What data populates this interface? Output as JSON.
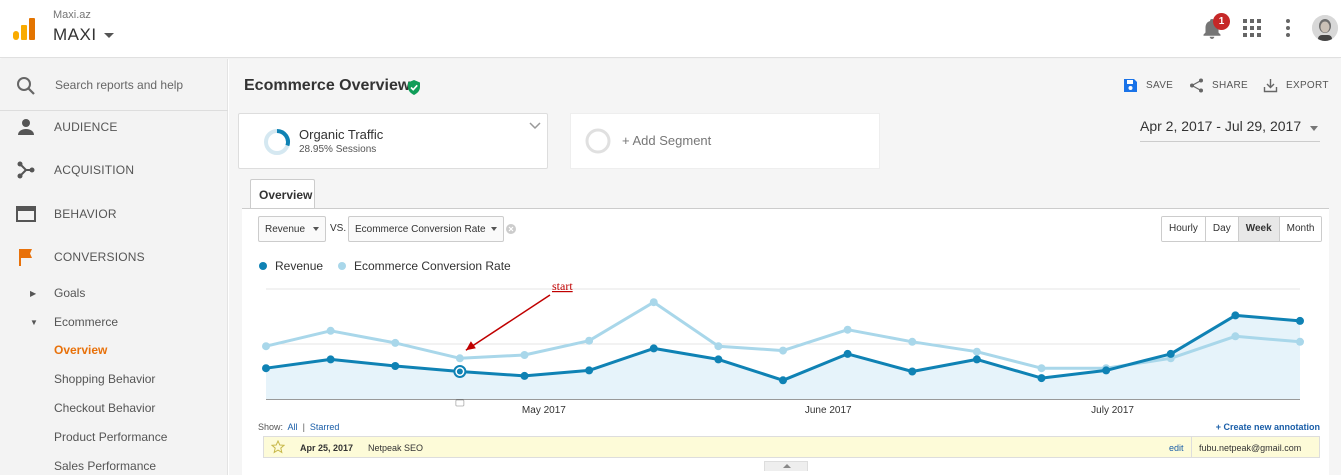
{
  "header": {
    "account_sub": "Maxi.az",
    "account_name": "MAXI",
    "notification_count": "1"
  },
  "sidebar": {
    "search_placeholder": "Search reports and help",
    "sections": [
      {
        "label": "AUDIENCE",
        "icon": "person-icon"
      },
      {
        "label": "ACQUISITION",
        "icon": "acquisition-icon"
      },
      {
        "label": "BEHAVIOR",
        "icon": "behavior-icon"
      },
      {
        "label": "CONVERSIONS",
        "icon": "flag-icon"
      }
    ],
    "sub_items": [
      {
        "label": "Goals",
        "arrow": "▶"
      },
      {
        "label": "Ecommerce",
        "arrow": "▼"
      },
      {
        "label": "Overview"
      },
      {
        "label": "Shopping Behavior"
      },
      {
        "label": "Checkout Behavior"
      },
      {
        "label": "Product Performance"
      },
      {
        "label": "Sales Performance"
      }
    ]
  },
  "main": {
    "title": "Ecommerce Overview",
    "actions": {
      "save": "SAVE",
      "share": "SHARE",
      "export": "EXPORT"
    },
    "segment": {
      "name": "Organic Traffic",
      "sub": "28.95% Sessions"
    },
    "add_segment": "+ Add Segment",
    "date_range": "Apr 2, 2017 - Jul 29, 2017",
    "tab": "Overview",
    "metric1": "Revenue",
    "vs": "VS.",
    "metric2": "Ecommerce Conversion Rate",
    "granularity": [
      "Hourly",
      "Day",
      "Week",
      "Month"
    ],
    "granularity_selected": "Week",
    "annotation_callout": "start",
    "annotations": {
      "show": "Show:",
      "all": "All",
      "divider": "|",
      "starred": "Starred",
      "create": "+ Create new annotation",
      "date": "Apr 25, 2017",
      "text": "Netpeak SEO",
      "edit": "edit",
      "email": "fubu.netpeak@gmail.com"
    }
  },
  "colors": {
    "revenue": "#0f82b4",
    "conversion": "#a9d7ea",
    "active": "#e8710a",
    "flag": "#e8710a"
  },
  "chart_data": {
    "type": "line",
    "x": [
      "Apr 2",
      "Apr 9",
      "Apr 16",
      "Apr 23",
      "Apr 30",
      "May 7",
      "May 14",
      "May 21",
      "May 28",
      "Jun 4",
      "Jun 11",
      "Jun 18",
      "Jun 25",
      "Jul 2",
      "Jul 9",
      "Jul 16",
      "Jul 23",
      "Jul 29"
    ],
    "x_tick_labels": [
      "May 2017",
      "June 2017",
      "July 2017"
    ],
    "x_tick_index": [
      4.3,
      8.7,
      13.1
    ],
    "series": [
      {
        "name": "Revenue",
        "values": [
          28,
          36,
          30,
          25,
          21,
          26,
          46,
          36,
          17,
          41,
          25,
          36,
          19,
          26,
          41,
          76,
          71
        ]
      },
      {
        "name": "Ecommerce Conversion Rate",
        "values": [
          48,
          62,
          51,
          37,
          40,
          53,
          88,
          48,
          44,
          63,
          52,
          43,
          28,
          28,
          37,
          57,
          52
        ]
      }
    ],
    "ylim": [
      0,
      100
    ],
    "highlight_index": 3,
    "grid": true
  }
}
